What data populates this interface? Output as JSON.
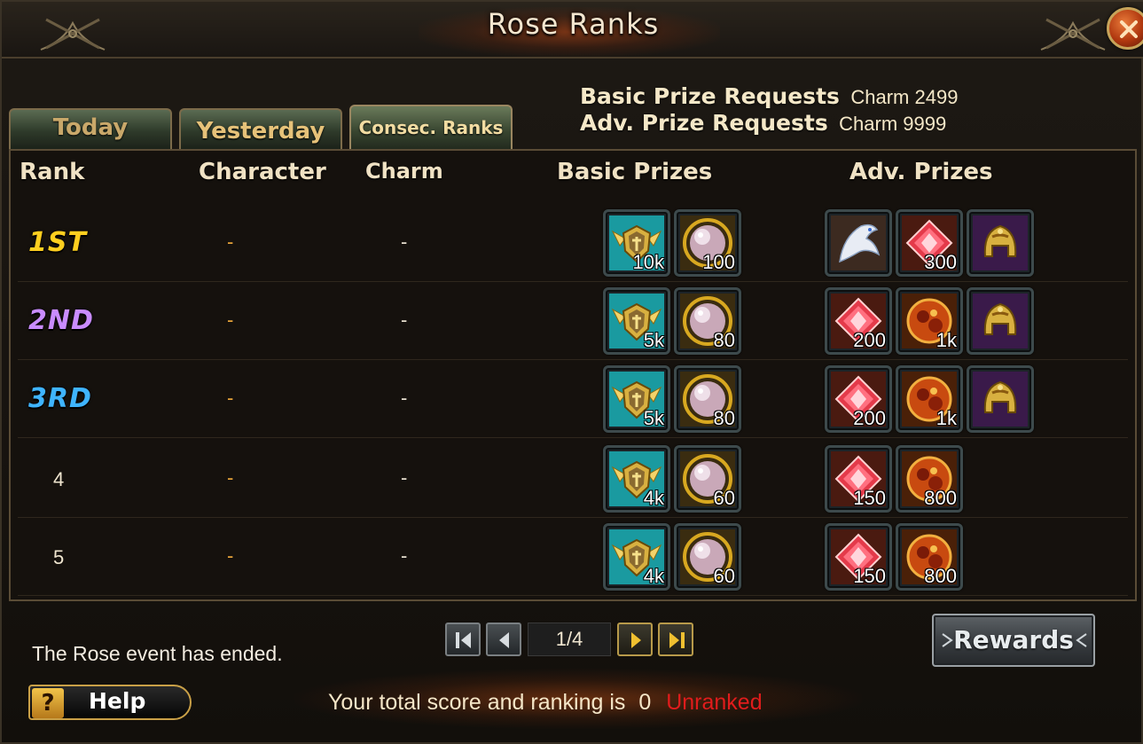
{
  "window": {
    "title": "Rose Ranks"
  },
  "tabs": [
    {
      "label": "Today"
    },
    {
      "label": "Yesterday"
    },
    {
      "label": "Consec. Ranks",
      "active": true
    }
  ],
  "requests": {
    "basic_label": "Basic Prize Requests",
    "basic_value": "Charm 2499",
    "adv_label": "Adv. Prize Requests",
    "adv_value": "Charm 9999"
  },
  "columns": {
    "rank": "Rank",
    "character": "Character",
    "charm": "Charm",
    "basic": "Basic Prizes",
    "adv": "Adv. Prizes"
  },
  "rows": [
    {
      "rank": "1ST",
      "rank_color": "#ffcf1f",
      "character": "-",
      "charm": "-",
      "basic": [
        {
          "icon": "crest-shield-icon",
          "qty": "10k"
        },
        {
          "icon": "pearl-orb-icon",
          "qty": "100"
        }
      ],
      "adv": [
        {
          "icon": "white-dragon-mount-icon",
          "qty": ""
        },
        {
          "icon": "red-gem-icon",
          "qty": "300"
        },
        {
          "icon": "golden-helmet-icon",
          "qty": ""
        }
      ]
    },
    {
      "rank": "2ND",
      "rank_color": "#c98cff",
      "character": "-",
      "charm": "-",
      "basic": [
        {
          "icon": "crest-shield-icon",
          "qty": "5k"
        },
        {
          "icon": "pearl-orb-icon",
          "qty": "80"
        }
      ],
      "adv": [
        {
          "icon": "red-gem-icon",
          "qty": "200"
        },
        {
          "icon": "fire-ore-icon",
          "qty": "1k"
        },
        {
          "icon": "golden-helmet-icon",
          "qty": ""
        }
      ]
    },
    {
      "rank": "3RD",
      "rank_color": "#3fb4ff",
      "character": "-",
      "charm": "-",
      "basic": [
        {
          "icon": "crest-shield-icon",
          "qty": "5k"
        },
        {
          "icon": "pearl-orb-icon",
          "qty": "80"
        }
      ],
      "adv": [
        {
          "icon": "red-gem-icon",
          "qty": "200"
        },
        {
          "icon": "fire-ore-icon",
          "qty": "1k"
        },
        {
          "icon": "golden-helmet-icon",
          "qty": ""
        }
      ]
    },
    {
      "rank": "4",
      "rank_color": "",
      "character": "-",
      "charm": "-",
      "basic": [
        {
          "icon": "crest-shield-icon",
          "qty": "4k"
        },
        {
          "icon": "pearl-orb-icon",
          "qty": "60"
        }
      ],
      "adv": [
        {
          "icon": "red-gem-icon",
          "qty": "150"
        },
        {
          "icon": "fire-ore-icon",
          "qty": "800"
        }
      ]
    },
    {
      "rank": "5",
      "rank_color": "",
      "character": "-",
      "charm": "-",
      "basic": [
        {
          "icon": "crest-shield-icon",
          "qty": "4k"
        },
        {
          "icon": "pearl-orb-icon",
          "qty": "60"
        }
      ],
      "adv": [
        {
          "icon": "red-gem-icon",
          "qty": "150"
        },
        {
          "icon": "fire-ore-icon",
          "qty": "800"
        }
      ]
    }
  ],
  "pager": {
    "page": "1/4"
  },
  "rewards_label": "Rewards",
  "event_status": "The Rose event has ended.",
  "help_label": "Help",
  "help_icon": "question-mark-icon",
  "score": {
    "text": "Your total score and ranking is",
    "value": "0",
    "status": "Unranked",
    "status_color": "#e01c1c"
  }
}
